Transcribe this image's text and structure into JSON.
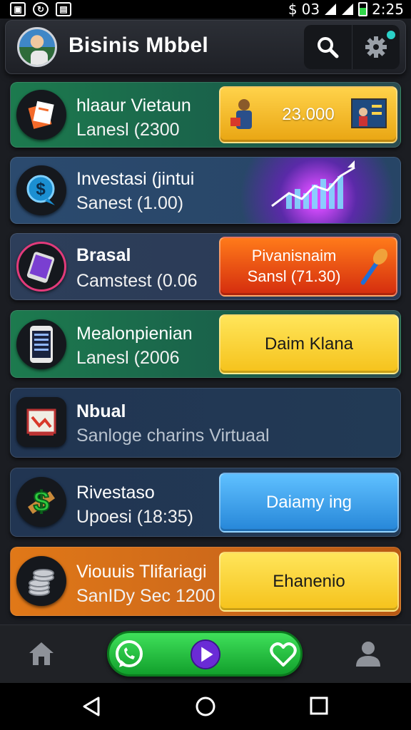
{
  "status_bar": {
    "time": "2:25",
    "network": "03"
  },
  "header": {
    "title": "Bisinis Mbbel"
  },
  "cards": [
    {
      "title": "hlaaur Vietaun",
      "subtitle": "Lanesl (2300",
      "action": "23.000"
    },
    {
      "title": "Investasi (jintui",
      "subtitle": "Sanest  (1.00)"
    },
    {
      "title": "Brasal",
      "subtitle": "Camstest (0.06",
      "action_line1": "Pivanisnaim",
      "action_line2": "Sansl (71.30)"
    },
    {
      "title": "Mealonpienian",
      "subtitle": "Lanesl (2006",
      "action": "Daim Klana"
    },
    {
      "title": "Nbual",
      "subtitle": "Sanloge charins Virtuaal"
    },
    {
      "title": "Rivestaso",
      "subtitle": "Upoesi (18:35)",
      "action": "Daiamy ing"
    },
    {
      "title": "Viouuis Tlifariagi",
      "subtitle": "SanIDy Sec 1200",
      "action": "Ehanenio"
    }
  ],
  "colors": {
    "accent_green": "#1aa83a",
    "yellow": "#f5c21b",
    "orange": "#e07818",
    "blue": "#2686d8"
  }
}
